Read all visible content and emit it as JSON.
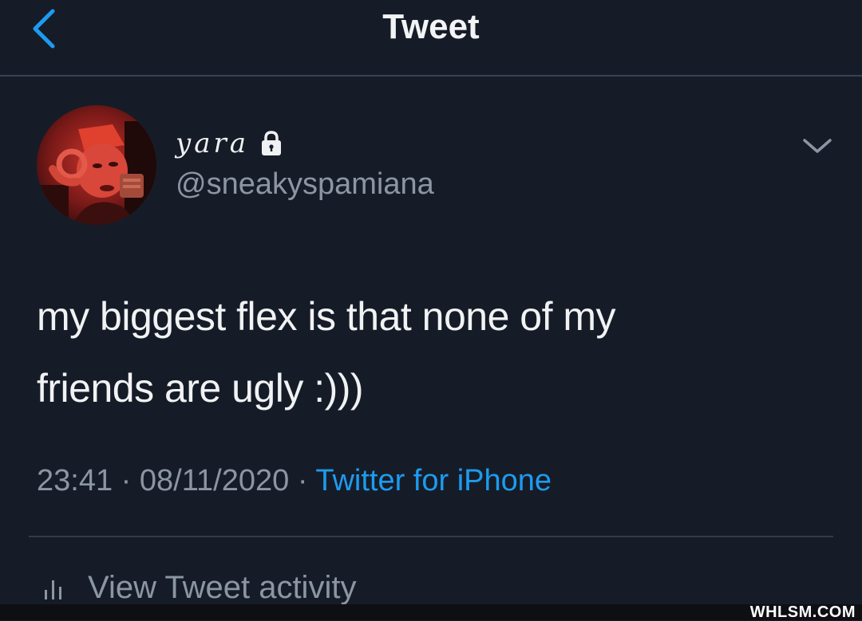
{
  "header": {
    "title": "Tweet",
    "back_icon": "chevron-left-icon"
  },
  "author": {
    "display_name": "yara",
    "handle": "@sneakyspamiana",
    "protected_icon": "lock-icon",
    "menu_icon": "chevron-down-icon"
  },
  "tweet": {
    "text_line1": "my biggest flex is that none of my",
    "text_line2": "friends are ugly :)))",
    "time": "23:41",
    "separator": "·",
    "date": "08/11/2020",
    "source": "Twitter for iPhone"
  },
  "activity": {
    "icon": "bar-chart-icon",
    "label": "View Tweet activity"
  },
  "watermark": "WHLSM.COM",
  "colors": {
    "background": "#161c27",
    "accent": "#1d9bf0",
    "secondary_text": "#8b96a3",
    "primary_text": "#f1f2f4"
  }
}
